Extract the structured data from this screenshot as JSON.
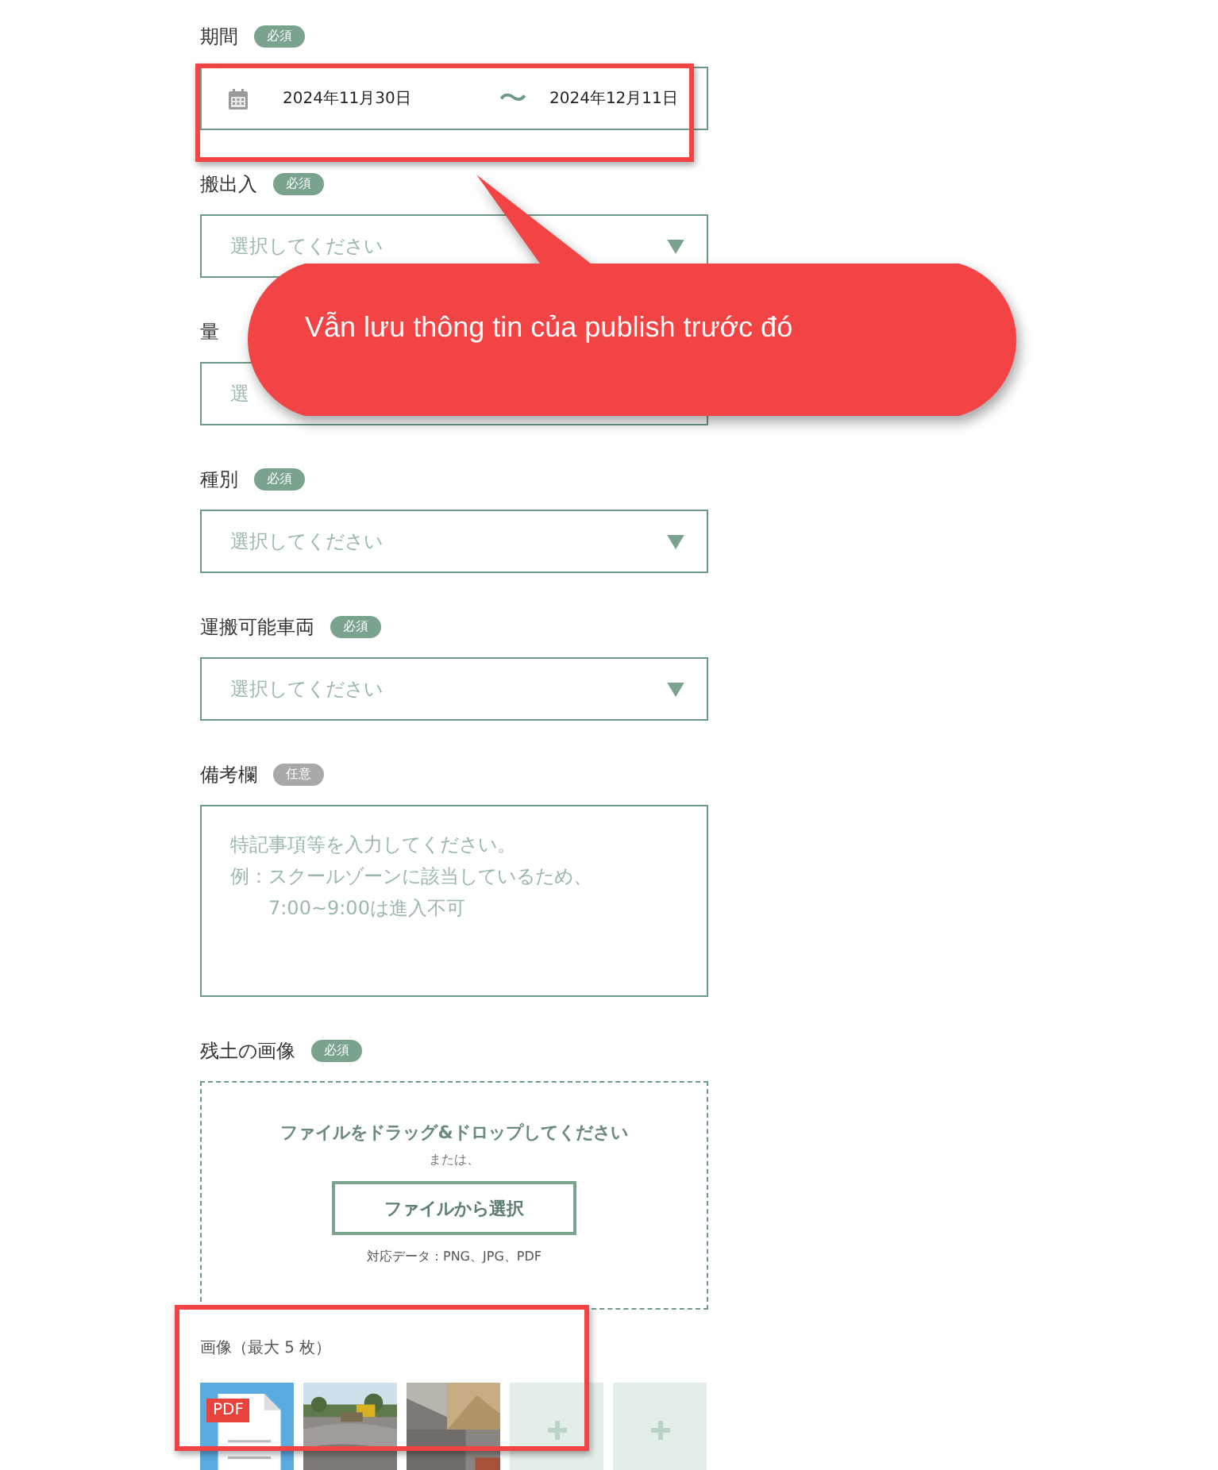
{
  "fields": [
    {
      "kind": "date_range",
      "label": "期間",
      "badge": "必須",
      "required": true,
      "highlighted": true,
      "start": "2024年11月30日",
      "separator": "〜",
      "end": "2024年12月11日"
    },
    {
      "kind": "select",
      "label": "搬出入",
      "badge": "必須",
      "required": true,
      "placeholder": "選択してください"
    },
    {
      "kind": "text",
      "label": "量",
      "placeholder": "選"
    },
    {
      "kind": "select",
      "label": "種別",
      "badge": "必須",
      "required": true,
      "placeholder": "選択してください"
    },
    {
      "kind": "select",
      "label": "運搬可能車両",
      "badge": "必須",
      "required": true,
      "placeholder": "選択してください"
    },
    {
      "kind": "textarea",
      "label": "備考欄",
      "badge": "任意",
      "required": false,
      "placeholder_lines": [
        "特記事項等を入力してください。",
        "例：スクールゾーンに該当しているため、",
        "7:00~9:00は進入不可"
      ]
    },
    {
      "kind": "upload",
      "label": "残土の画像",
      "badge": "必須",
      "required": true,
      "drop_text": "ファイルをドラッグ&ドロップしてください",
      "or_text": "または、",
      "button": "ファイルから選択",
      "formats": "対応データ：PNG、JPG、PDF"
    }
  ],
  "images": {
    "label": "画像（最大 5 枚）",
    "highlighted": true,
    "tiles": [
      {
        "kind": "pdf",
        "tag": "PDF"
      },
      {
        "kind": "picture"
      },
      {
        "kind": "picture"
      },
      {
        "kind": "empty"
      },
      {
        "kind": "empty"
      }
    ]
  },
  "callout": {
    "text": "Vẫn lưu thông tin của publish trước đó"
  }
}
